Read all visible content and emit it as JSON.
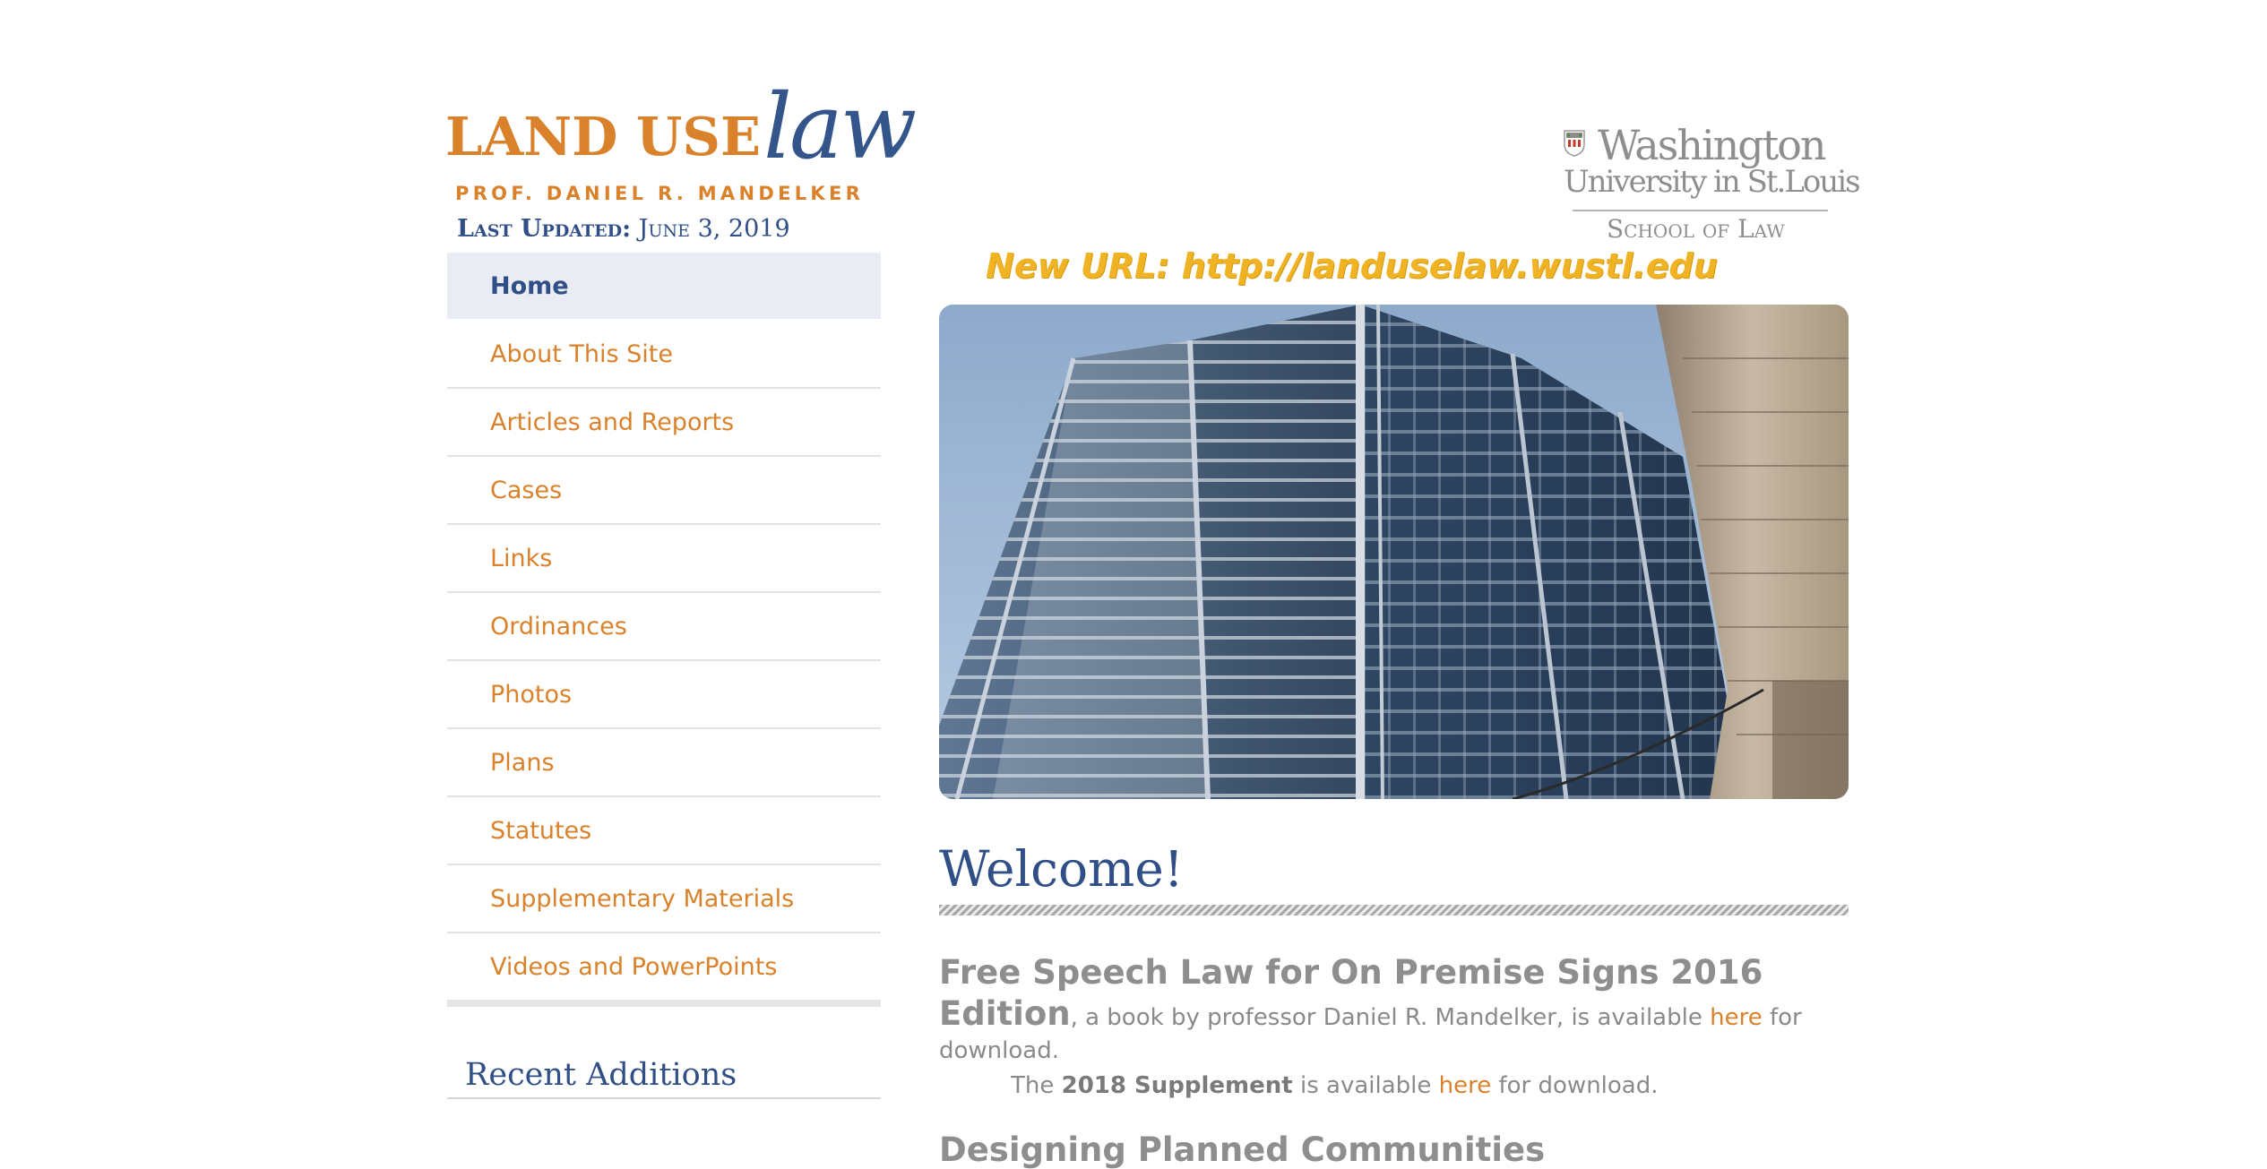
{
  "header": {
    "logo_land": "LAND USE",
    "logo_law": "law",
    "author": "PROF. DANIEL R. MANDELKER",
    "updated_label": "Last Updated:",
    "updated_date": "June 3, 2019"
  },
  "nav": {
    "items": [
      {
        "label": "Home",
        "active": true
      },
      {
        "label": "About This Site"
      },
      {
        "label": "Articles and Reports"
      },
      {
        "label": "Cases"
      },
      {
        "label": "Links"
      },
      {
        "label": "Ordinances"
      },
      {
        "label": "Photos"
      },
      {
        "label": "Plans"
      },
      {
        "label": "Statutes"
      },
      {
        "label": "Supplementary Materials"
      },
      {
        "label": "Videos and PowerPoints"
      }
    ]
  },
  "sidebar": {
    "recent_title": "Recent Additions"
  },
  "wu_logo": {
    "name": "Washington",
    "university": "University in St.Louis",
    "school": "School of Law"
  },
  "banner": {
    "new_url": "New URL: http://landuselaw.wustl.edu"
  },
  "main": {
    "welcome": "Welcome!",
    "article1": {
      "title_part1": "Free Speech Law for On Premise Signs 2016",
      "title_part2": "Edition",
      "desc": ", a book by professor Daniel R. Mandelker, is available ",
      "link": "here",
      "desc_after": " for",
      "desc_line2": "download.",
      "supp_prefix": "The ",
      "supp_bold": "2018 Supplement",
      "supp_mid": " is available ",
      "supp_link": "here",
      "supp_suffix": " for download."
    },
    "article2_title": "Designing Planned Communities"
  },
  "colors": {
    "orange": "#d9822b",
    "navy": "#2f4f86",
    "gold": "#f0b323",
    "gray_text": "#8a8a8a"
  }
}
